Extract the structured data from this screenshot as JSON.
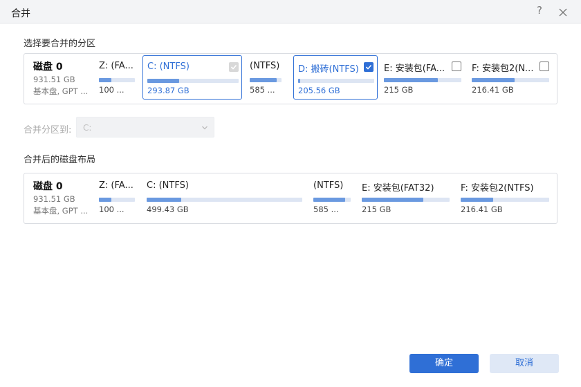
{
  "window": {
    "title": "合并",
    "help": "?"
  },
  "select_section": {
    "label": "选择要合并的分区",
    "disk": {
      "name": "磁盘 0",
      "size": "931.51 GB",
      "type": "基本盘, GPT ..."
    },
    "partitions": [
      {
        "label": "Z: (FA...",
        "size": "100 ...",
        "used": 0.35,
        "checkbox": "disabled"
      },
      {
        "label": "C: (NTFS)",
        "size": "293.87 GB",
        "used": 0.35,
        "checkbox": "disabled",
        "selected": true
      },
      {
        "label": "(NTFS)",
        "size": "585 ...",
        "used": 0.85,
        "checkbox": "none"
      },
      {
        "label": "D: 搬砖(NTFS)",
        "size": "205.56 GB",
        "used": 0.03,
        "checkbox": "checked",
        "selected": true
      },
      {
        "label": "E: 安装包(FA...",
        "size": "215 GB",
        "used": 0.7,
        "checkbox": "unchecked"
      },
      {
        "label": "F: 安装包2(N...",
        "size": "216.41 GB",
        "used": 0.55,
        "checkbox": "unchecked"
      }
    ]
  },
  "merge_to": {
    "label": "合并分区到:",
    "value": "C:"
  },
  "result_section": {
    "label": "合并后的磁盘布局",
    "disk": {
      "name": "磁盘 0",
      "size": "931.51 GB",
      "type": "基本盘, GPT ..."
    },
    "partitions": [
      {
        "label": "Z: (FA...",
        "size": "100 ...",
        "used": 0.35
      },
      {
        "label": "C: (NTFS)",
        "size": "499.43 GB",
        "used": 0.22
      },
      {
        "label": "(NTFS)",
        "size": "585 ...",
        "used": 0.85
      },
      {
        "label": "E: 安装包(FAT32)",
        "size": "215 GB",
        "used": 0.7
      },
      {
        "label": "F: 安装包2(NTFS)",
        "size": "216.41 GB",
        "used": 0.37
      }
    ]
  },
  "buttons": {
    "ok": "确定",
    "cancel": "取消"
  },
  "colors": {
    "accent": "#2f6fd6",
    "bar_fill": "#6a99e0",
    "bar_track": "#dde5f3"
  },
  "icons": {
    "close": "close-icon",
    "help": "help-icon",
    "dropdown": "chevron-down-icon",
    "check": "checkmark-icon"
  }
}
